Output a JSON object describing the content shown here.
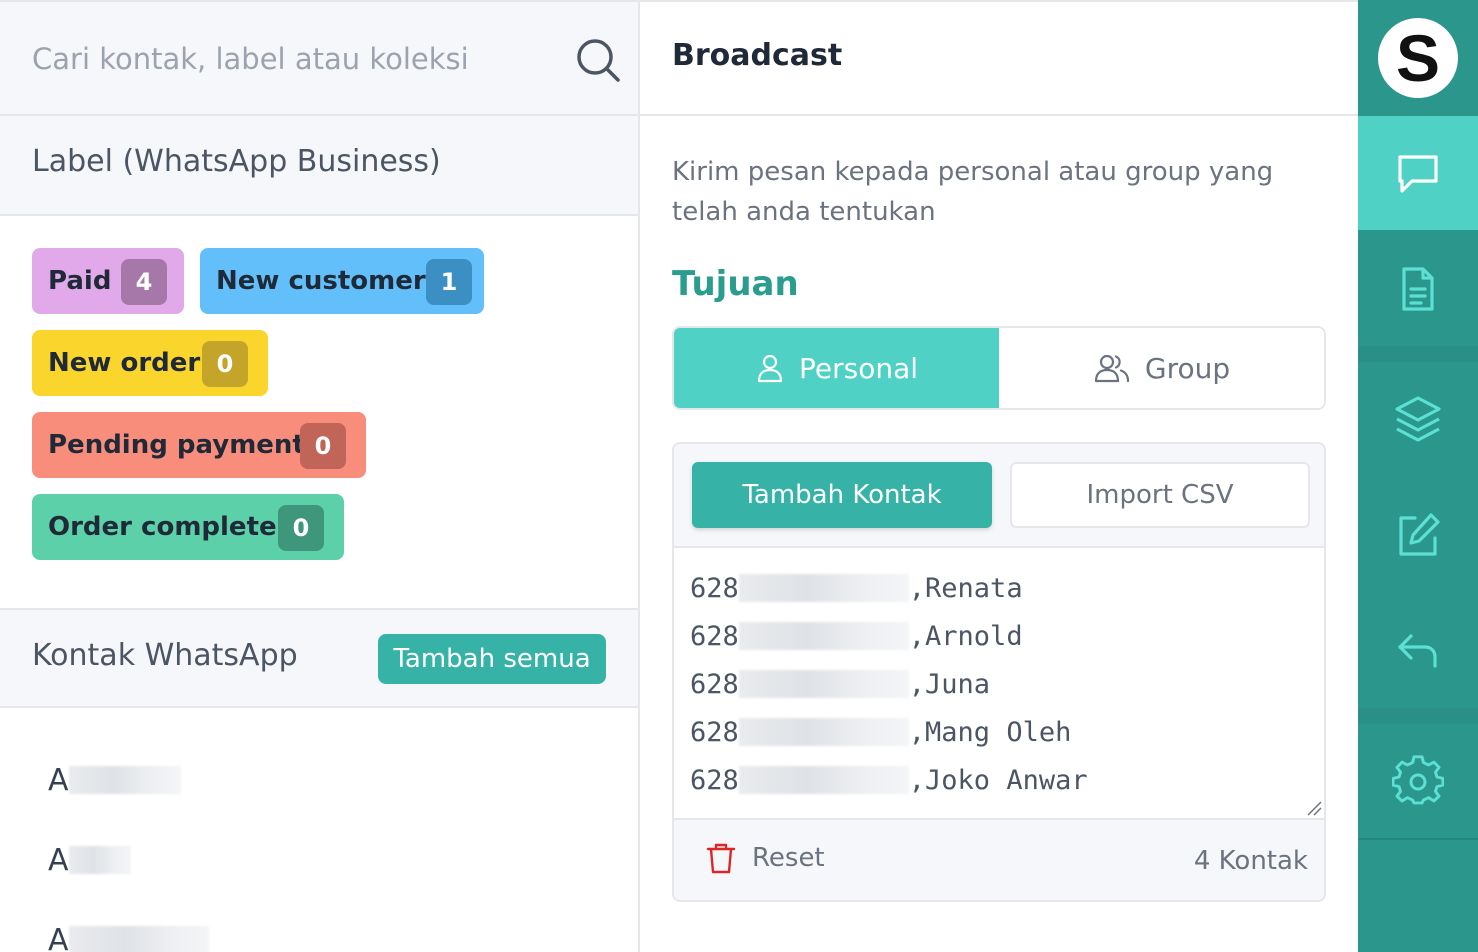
{
  "search": {
    "placeholder": "Cari kontak, label atau koleksi"
  },
  "labels": {
    "title": "Label (WhatsApp Business)",
    "items": [
      {
        "name": "Paid",
        "count": "4",
        "color": "#e2a9ea",
        "count_color": "#a678a9"
      },
      {
        "name": "New customer",
        "count": "1",
        "color": "#63bffa",
        "count_color": "#3c8fc3"
      },
      {
        "name": "New order",
        "count": "0",
        "color": "#fad52c",
        "count_color": "#c4a52a"
      },
      {
        "name": "Pending payment",
        "count": "0",
        "color": "#f98d7c",
        "count_color": "#c06557"
      },
      {
        "name": "Order complete",
        "count": "0",
        "color": "#5cd0a8",
        "count_color": "#3f977b"
      }
    ]
  },
  "kontak": {
    "title": "Kontak WhatsApp",
    "add_all_label": "Tambah semua",
    "contacts": [
      "A",
      "A",
      "A"
    ]
  },
  "broadcast": {
    "title": "Broadcast",
    "description": "Kirim pesan kepada personal atau group yang telah anda tentukan",
    "tujuan_label": "Tujuan",
    "tabs": [
      {
        "label": "Personal",
        "active": true
      },
      {
        "label": "Group",
        "active": false
      }
    ],
    "add_contact_label": "Tambah Kontak",
    "import_csv_label": "Import CSV",
    "recipients": [
      {
        "prefix": "628",
        "name": ",Renata"
      },
      {
        "prefix": "628",
        "name": ",Arnold"
      },
      {
        "prefix": "628",
        "name": ",Juna"
      },
      {
        "prefix": "628",
        "name": ",Mang Oleh"
      },
      {
        "prefix": "628",
        "name": ",Joko Anwar"
      }
    ],
    "reset_label": "Reset",
    "count_label": "4 Kontak"
  },
  "sidebar": {
    "logo_letter": "S",
    "items": [
      {
        "icon": "chat-icon",
        "active": true
      },
      {
        "icon": "document-icon",
        "active": false
      },
      {
        "icon": "layers-icon",
        "active": false
      },
      {
        "icon": "edit-icon",
        "active": false
      },
      {
        "icon": "reply-icon",
        "active": false
      },
      {
        "icon": "settings-icon",
        "active": false
      }
    ]
  },
  "colors": {
    "accent": "#4fd1c5",
    "accent_dark": "#36b3a6",
    "sidebar": "#2b968c",
    "heading_teal": "#2a9d8f"
  }
}
